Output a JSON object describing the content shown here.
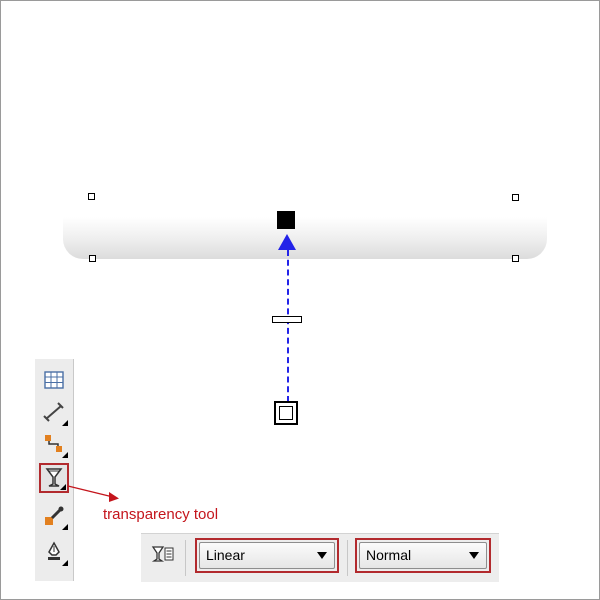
{
  "annotation": {
    "label": "transparency tool",
    "color": "#c4151c"
  },
  "colors": {
    "interactive_vector": "#2323e8",
    "highlight_outline": "#b22a2e"
  },
  "toolbox": {
    "items": [
      {
        "icon": "table-icon",
        "selected": false
      },
      {
        "icon": "dimension-tool-icon",
        "selected": false
      },
      {
        "icon": "connector-tool-icon",
        "selected": false
      },
      {
        "icon": "transparency-tool-icon",
        "selected": true
      },
      {
        "icon": "eyedropper-tool-icon",
        "selected": false
      },
      {
        "icon": "outline-pen-icon",
        "selected": false
      }
    ]
  },
  "property_bar": {
    "icon": "transparency-properties-icon",
    "transparency_type": "Linear",
    "merge_mode": "Normal"
  }
}
